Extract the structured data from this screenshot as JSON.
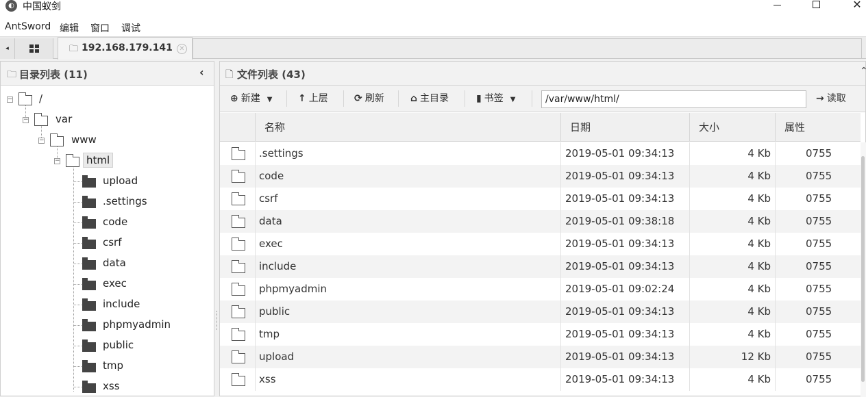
{
  "window": {
    "title": "中国蚁剑",
    "controls": {
      "minimize": "minimize-icon",
      "maximize": "maximize-icon",
      "close": "✕"
    }
  },
  "menu": [
    "AntSword",
    "编辑",
    "窗口",
    "调试"
  ],
  "tabs": {
    "scroll_left": "◂",
    "home_icon": "grid-icon",
    "active_label": "192.168.179.141",
    "close_glyph": "✕"
  },
  "left_panel": {
    "title": "目录列表 (11)",
    "collapse_glyph": "‹",
    "tree": {
      "root": "/",
      "level1": "var",
      "level2": "www",
      "level3": "html",
      "children": [
        "upload",
        ".settings",
        "code",
        "csrf",
        "data",
        "exec",
        "include",
        "phpmyadmin",
        "public",
        "tmp",
        "xss"
      ]
    }
  },
  "right_panel": {
    "title": "文件列表 (43)",
    "toolbar": {
      "new_label": "新建",
      "up_label": "上层",
      "refresh_label": "刷新",
      "home_label": "主目录",
      "bookmark_label": "书签",
      "path_value": "/var/www/html/",
      "read_label": "读取"
    },
    "columns": [
      "名称",
      "日期",
      "大小",
      "属性"
    ],
    "files": [
      {
        "name": ".settings",
        "date": "2019-05-01 09:34:13",
        "size": "4 Kb",
        "attr": "0755"
      },
      {
        "name": "code",
        "date": "2019-05-01 09:34:13",
        "size": "4 Kb",
        "attr": "0755"
      },
      {
        "name": "csrf",
        "date": "2019-05-01 09:34:13",
        "size": "4 Kb",
        "attr": "0755"
      },
      {
        "name": "data",
        "date": "2019-05-01 09:38:18",
        "size": "4 Kb",
        "attr": "0755"
      },
      {
        "name": "exec",
        "date": "2019-05-01 09:34:13",
        "size": "4 Kb",
        "attr": "0755"
      },
      {
        "name": "include",
        "date": "2019-05-01 09:34:13",
        "size": "4 Kb",
        "attr": "0755"
      },
      {
        "name": "phpmyadmin",
        "date": "2019-05-01 09:02:24",
        "size": "4 Kb",
        "attr": "0755"
      },
      {
        "name": "public",
        "date": "2019-05-01 09:34:13",
        "size": "4 Kb",
        "attr": "0755"
      },
      {
        "name": "tmp",
        "date": "2019-05-01 09:34:13",
        "size": "4 Kb",
        "attr": "0755"
      },
      {
        "name": "upload",
        "date": "2019-05-01 09:34:13",
        "size": "12 Kb",
        "attr": "0755"
      },
      {
        "name": "xss",
        "date": "2019-05-01 09:34:13",
        "size": "4 Kb",
        "attr": "0755"
      }
    ]
  }
}
